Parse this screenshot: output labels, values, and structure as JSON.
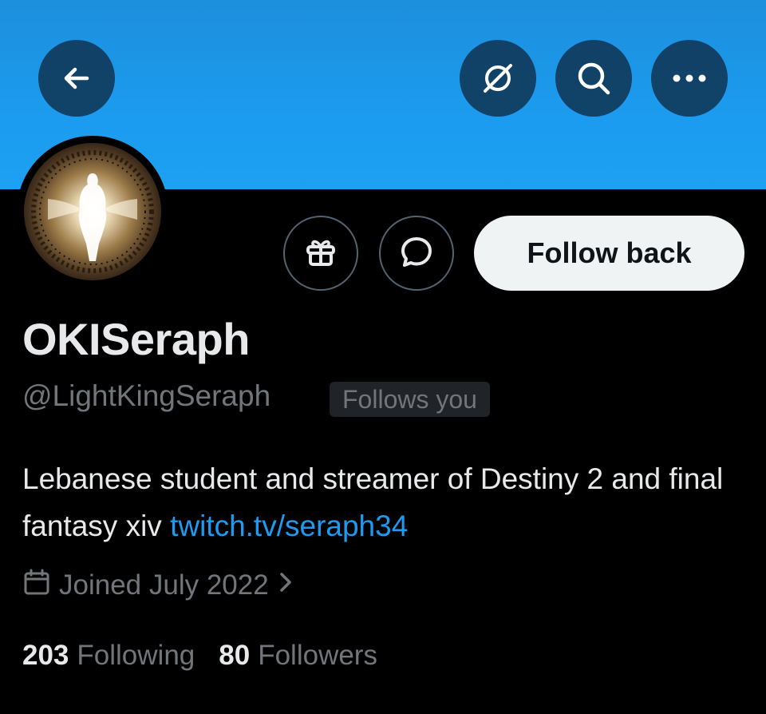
{
  "header": {
    "back_icon": "arrow-left-icon",
    "grok_icon": "slash-circle-icon",
    "search_icon": "search-icon",
    "more_icon": "more-horizontal-icon",
    "banner_color": "#1d9bf0"
  },
  "profile": {
    "display_name": "OKISeraph",
    "handle": "@LightKingSeraph",
    "follows_you": "Follows you",
    "bio_text": "Lebanese student and streamer of Destiny 2 and final fantasy xiv ",
    "bio_link": "twitch.tv/seraph34",
    "joined": "Joined July 2022",
    "joined_icon": "calendar-icon"
  },
  "actions": {
    "gift_icon": "gift-icon",
    "message_icon": "message-bubble-icon",
    "follow_back_label": "Follow back"
  },
  "stats": {
    "following_count": "203",
    "following_label": "Following",
    "followers_count": "80",
    "followers_label": "Followers"
  },
  "colors": {
    "accent": "#1d9bf0",
    "background": "#000000",
    "secondary_text": "#71767b",
    "button_light": "#eff3f4"
  }
}
